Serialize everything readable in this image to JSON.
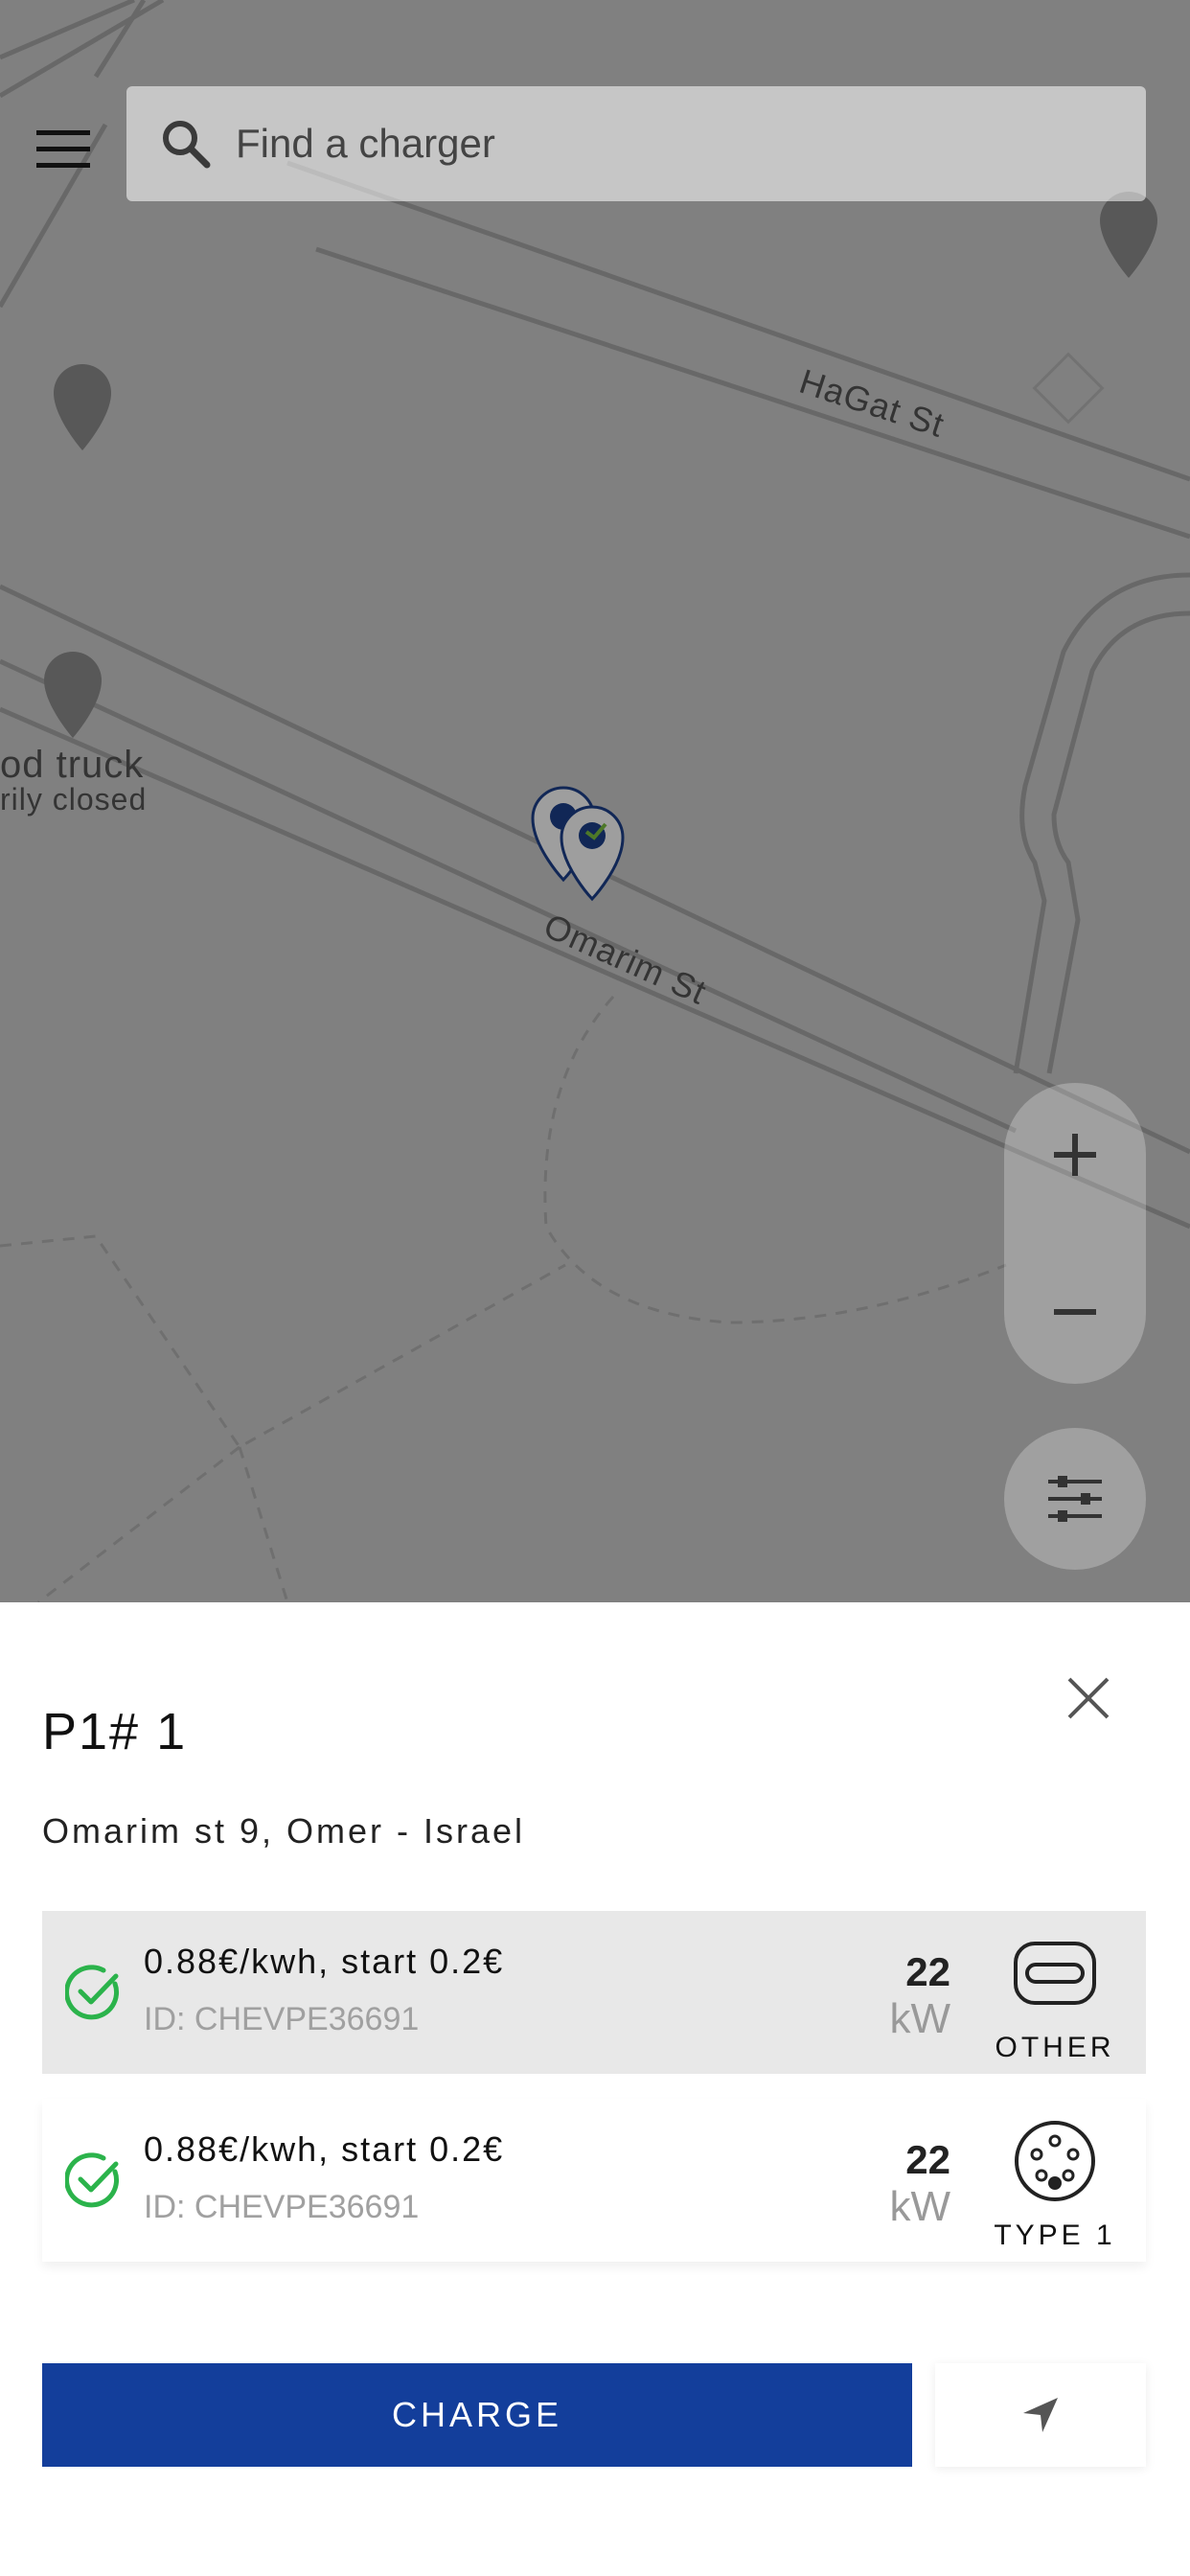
{
  "search": {
    "placeholder": "Find a charger"
  },
  "map": {
    "streets": [
      "HaGat St",
      "Omarim St"
    ],
    "poi": {
      "name_line1": "od truck",
      "name_line2": "rily closed"
    }
  },
  "station": {
    "title": "P1# 1",
    "address": "Omarim st 9, Omer - Israel"
  },
  "connectors": [
    {
      "price": "0.88€/kwh, start 0.2€",
      "id": "ID: CHEVPE36691",
      "power": "22",
      "unit": "kW",
      "type": "OTHER"
    },
    {
      "price": "0.88€/kwh, start 0.2€",
      "id": "ID: CHEVPE36691",
      "power": "22",
      "unit": "kW",
      "type": "TYPE 1"
    }
  ],
  "actions": {
    "charge_label": "CHARGE"
  },
  "colors": {
    "primary": "#133e9b",
    "check": "#2bb34b",
    "selected_row": "#e8e8e8"
  },
  "icons": [
    "menu-icon",
    "search-icon",
    "plus-icon",
    "minus-icon",
    "filter-icon",
    "close-icon",
    "check-circle-icon",
    "plug-other-icon",
    "plug-type1-icon",
    "navigate-icon",
    "charger-pin-icon"
  ]
}
